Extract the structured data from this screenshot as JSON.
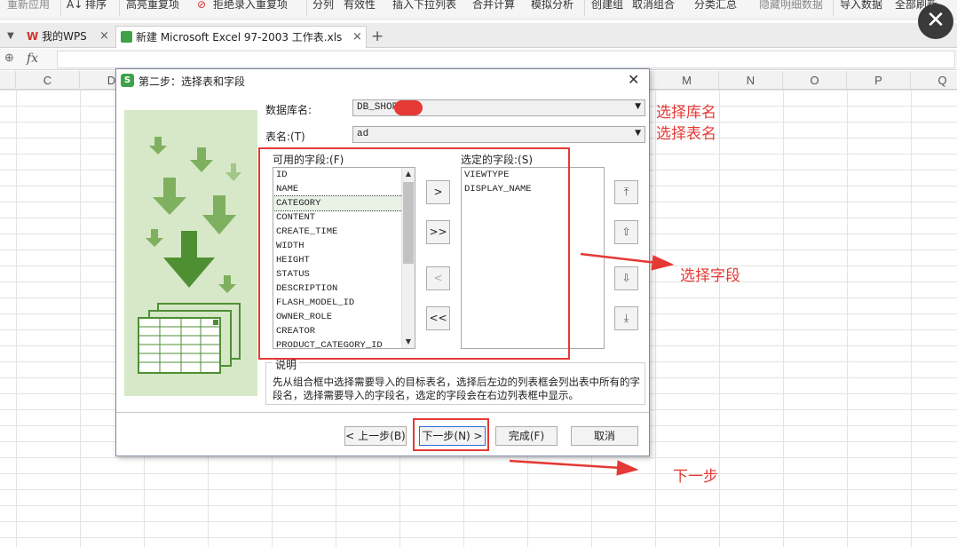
{
  "ribbon": {
    "items": [
      "重新应用",
      "排序",
      "高亮重复项",
      "拒绝录入重复项",
      "分列",
      "有效性",
      "插入下拉列表",
      "合并计算",
      "模拟分析",
      "创建组",
      "取消组合",
      "分类汇总",
      "隐藏明细数据",
      "导入数据",
      "全部刷新"
    ]
  },
  "tabs": {
    "home": "我的WPS",
    "doc": "新建 Microsoft Excel 97-2003 工作表.xls",
    "add": "+"
  },
  "formula": {
    "fx": "fx"
  },
  "columns": [
    "C",
    "D",
    "",
    "",
    "",
    "",
    "",
    "",
    "",
    "M",
    "N",
    "O",
    "P",
    "Q"
  ],
  "dialog": {
    "title": "第二步：选择表和字段",
    "db_label": "数据库名:",
    "db_value": "DB_SHOP",
    "table_label": "表名:(T)",
    "table_value": "ad",
    "available_label": "可用的字段:(F)",
    "selected_label": "选定的字段:(S)",
    "available_fields": [
      "ID",
      "NAME",
      "CATEGORY",
      "CONTENT",
      "CREATE_TIME",
      "WIDTH",
      "HEIGHT",
      "STATUS",
      "DESCRIPTION",
      "FLASH_MODEL_ID",
      "OWNER_ROLE",
      "CREATOR",
      "PRODUCT_CATEGORY_ID"
    ],
    "selected_index": 2,
    "selected_fields": [
      "VIEWTYPE",
      "DISPLAY_NAME"
    ],
    "move_buttons": [
      ">",
      ">>",
      "<",
      "<<"
    ],
    "desc_legend": "说明",
    "desc_text": "先从组合框中选择需要导入的目标表名，选择后左边的列表框会列出表中所有的字段名，选择需要导入的字段名，选定的字段会在右边列表框中显示。",
    "prev_button": "< 上一步(B)",
    "next_button": "下一步(N) >",
    "finish_button": "完成(F)",
    "cancel_button": "取消"
  },
  "annotations": {
    "select_db": "选择库名",
    "select_table": "选择表名",
    "select_fields": "选择字段",
    "next_step": "下一步"
  },
  "colors": {
    "annotation": "#e53935",
    "wps_green": "#3fa24a",
    "art_bg": "#d6e8c7"
  }
}
